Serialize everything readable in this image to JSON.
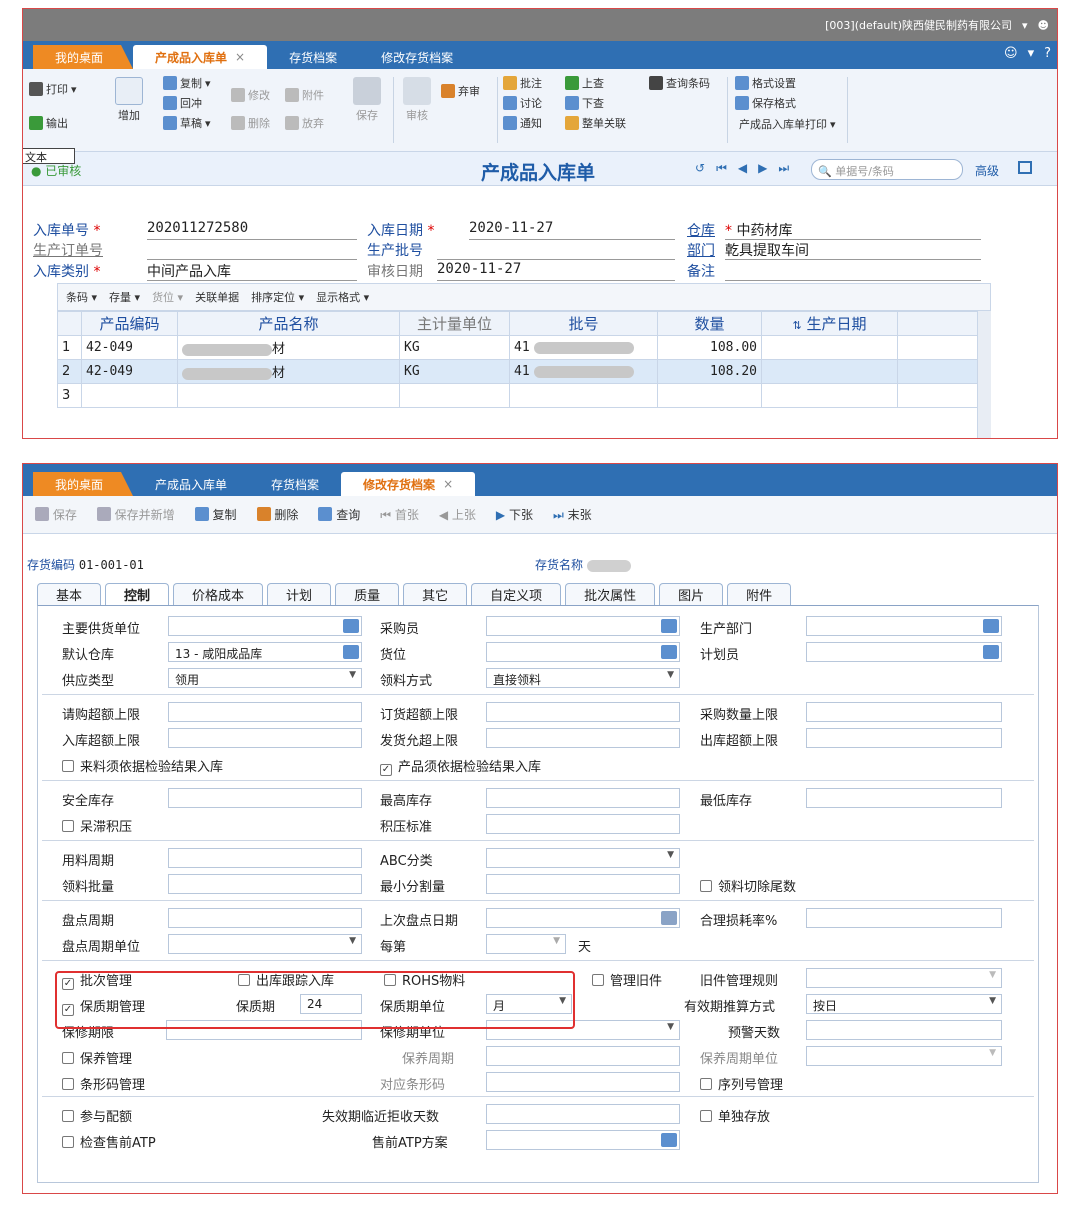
{
  "f1": {
    "title_info": "[003](default)陕西健民制药有限公司",
    "tabs": [
      "我的桌面",
      "产成品入库单",
      "存货档案",
      "修改存货档案"
    ],
    "tab_close": "×",
    "ribbon": {
      "print": "打印",
      "export": "输出",
      "add": "增加",
      "copy": "复制",
      "redflush": "回冲",
      "draft": "草稿",
      "modify": "修改",
      "attach": "附件",
      "delete": "删除",
      "abandon": "放弃",
      "save": "保存",
      "audit": "审核",
      "discard": "弃审",
      "annotate": "批注",
      "discuss": "讨论",
      "notify": "通知",
      "lookup_up": "上查",
      "lookup_down": "下查",
      "doc_link": "整单关联",
      "query_barcode": "查询条码",
      "format_settings": "格式设置",
      "save_format": "保存格式",
      "print_template": "产成品入库单打印"
    },
    "stamp_text": "文本",
    "status_text": "已审核",
    "form_title": "产成品入库单",
    "search_placeholder": "单据号/条码",
    "advanced": "高级",
    "fields": {
      "rk_no_label": "入库单号",
      "rk_no": "202011272580",
      "prod_order_label": "生产订单号",
      "rk_type_label": "入库类别",
      "rk_type": "中间产品入库",
      "rk_date_label": "入库日期",
      "rk_date": "2020-11-27",
      "batch_label": "生产批号",
      "audit_date_label": "审核日期",
      "audit_date": "2020-11-27",
      "warehouse_label": "仓库",
      "warehouse": "中药材库",
      "dept_label": "部门",
      "dept": "乾具提取车间",
      "remark_label": "备注"
    },
    "grid_toolbar": [
      "条码",
      "存量",
      "货位",
      "关联单据",
      "排序定位",
      "显示格式"
    ],
    "grid_headers": [
      "产品编码",
      "产品名称",
      "主计量单位",
      "批号",
      "数量",
      "生产日期"
    ],
    "rows": [
      {
        "no": "1",
        "code": "42-049",
        "name_tail": "材",
        "unit": "KG",
        "batch_prefix": "41",
        "qty": "108.00"
      },
      {
        "no": "2",
        "code": "42-049",
        "name_tail": "材",
        "unit": "KG",
        "batch_prefix": "41",
        "qty": "108.20"
      },
      {
        "no": "3"
      }
    ]
  },
  "f2": {
    "tabs": [
      "我的桌面",
      "产成品入库单",
      "存货档案",
      "修改存货档案"
    ],
    "toolbar": [
      "保存",
      "保存并新增",
      "复制",
      "删除",
      "查询",
      "首张",
      "上张",
      "下张",
      "末张"
    ],
    "code_label": "存货编码",
    "code_value": "01-001-01",
    "name_label": "存货名称",
    "subtabs": [
      "基本",
      "控制",
      "价格成本",
      "计划",
      "质量",
      "其它",
      "自定义项",
      "批次属性",
      "图片",
      "附件"
    ],
    "labels": {
      "main_supplier": "主要供货单位",
      "buyer": "采购员",
      "prod_dept": "生产部门",
      "default_wh": "默认仓库",
      "location": "货位",
      "planner": "计划员",
      "supply_type": "供应类型",
      "issue_method": "领料方式",
      "req_over": "请购超额上限",
      "order_over": "订货超额上限",
      "purchase_qty_limit": "采购数量上限",
      "in_over": "入库超额上限",
      "ship_over": "发货允超上限",
      "out_over": "出库超额上限",
      "check_in": "来料须依据检验结果入库",
      "prod_check_in": "产品须依据检验结果入库",
      "safety_stock": "安全库存",
      "max_stock": "最高库存",
      "min_stock": "最低库存",
      "slow_moving": "呆滞积压",
      "backlog_std": "积压标准",
      "usage_cycle": "用料周期",
      "abc": "ABC分类",
      "issue_batch": "领料批量",
      "min_split": "最小分割量",
      "cut_tail": "领料切除尾数",
      "count_cycle": "盘点周期",
      "last_count": "上次盘点日期",
      "loss_rate": "合理损耗率%",
      "count_unit": "盘点周期单位",
      "every": "每第",
      "day": "天",
      "batch_mgmt": "批次管理",
      "out_track": "出库跟踪入库",
      "rohs": "ROHS物料",
      "old_mgmt": "管理旧件",
      "old_rule": "旧件管理规则",
      "shelf_mgmt": "保质期管理",
      "shelf_life": "保质期",
      "shelf_unit": "保质期单位",
      "expiry_calc": "有效期推算方式",
      "warranty_limit": "保修期限",
      "warranty_unit": "保修期单位",
      "warn_days": "预警天数",
      "maint_mgmt": "保养管理",
      "maint_cycle": "保养周期",
      "maint_unit": "保养周期单位",
      "barcode_mgmt": "条形码管理",
      "barcode": "对应条形码",
      "serial_mgmt": "序列号管理",
      "allocation": "参与配额",
      "reject_days": "失效期临近拒收天数",
      "single_store": "单独存放",
      "atp_check": "检查售前ATP",
      "atp_plan": "售前ATP方案"
    },
    "values": {
      "default_wh": "13 - 咸阳成品库",
      "supply_type": "领用",
      "issue_method": "直接领料",
      "shelf_life": "24",
      "shelf_unit": "月",
      "expiry_calc": "按日"
    }
  }
}
